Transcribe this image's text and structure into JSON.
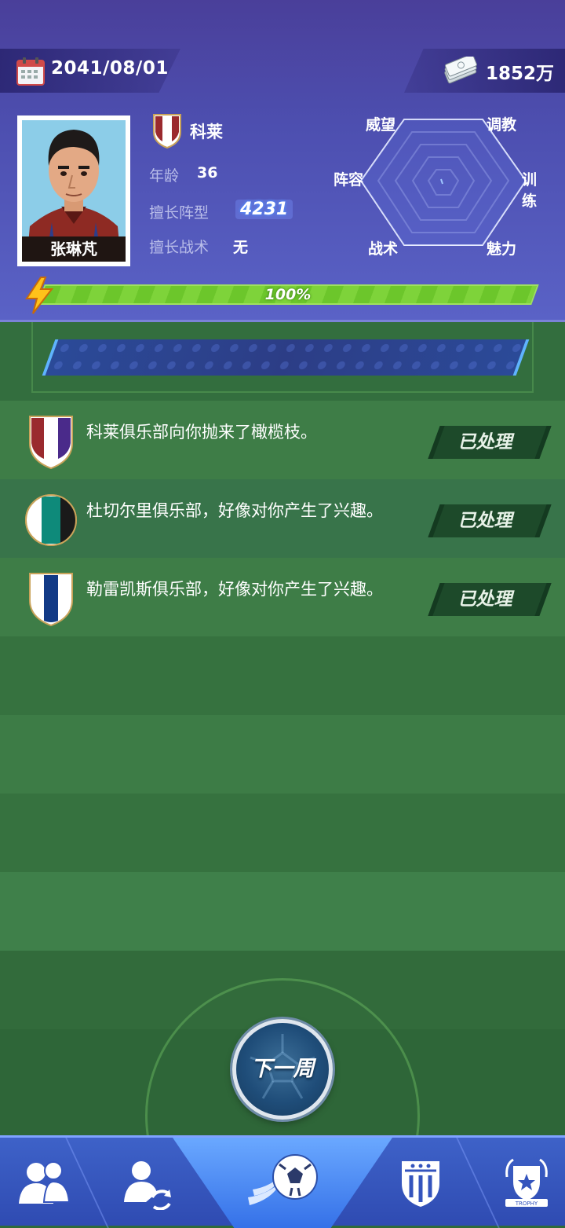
{
  "header": {
    "date": "2041/08/01",
    "money": "1852万",
    "coach_name": "张琳芃",
    "club_name": "科莱",
    "age_label": "年龄",
    "age_value": "36",
    "formation_label": "擅长阵型",
    "formation_value": "4231",
    "tactic_label": "擅长战术",
    "tactic_value": "无",
    "energy_text": "100%",
    "energy_percent": 100
  },
  "radar": {
    "labels": {
      "prestige": "威望",
      "coaching": "调教",
      "lineup": "阵容",
      "training": "训练",
      "tactics": "战术",
      "charisma": "魅力"
    }
  },
  "messages": [
    {
      "text": "科莱俱乐部向你抛来了橄榄枝。",
      "button": "已处理",
      "badge": "shield-red-purple"
    },
    {
      "text": "杜切尔里俱乐部，好像对你产生了兴趣。",
      "button": "已处理",
      "badge": "circle-teal-black"
    },
    {
      "text": "勒雷凯斯俱乐部，好像对你产生了兴趣。",
      "button": "已处理",
      "badge": "shield-navy-white"
    }
  ],
  "next_week_label": "下一周",
  "nav": {
    "items": [
      "team-icon",
      "transfer-icon",
      "match-icon",
      "club-icon",
      "trophy-icon"
    ],
    "trophy_text": "TROPHY",
    "active_index": 2
  },
  "colors": {
    "header_bg": "#4d4fb0",
    "energy_green": "#6cc62b",
    "field_green": "#3a7a44",
    "nav_blue": "#3e62c8"
  }
}
